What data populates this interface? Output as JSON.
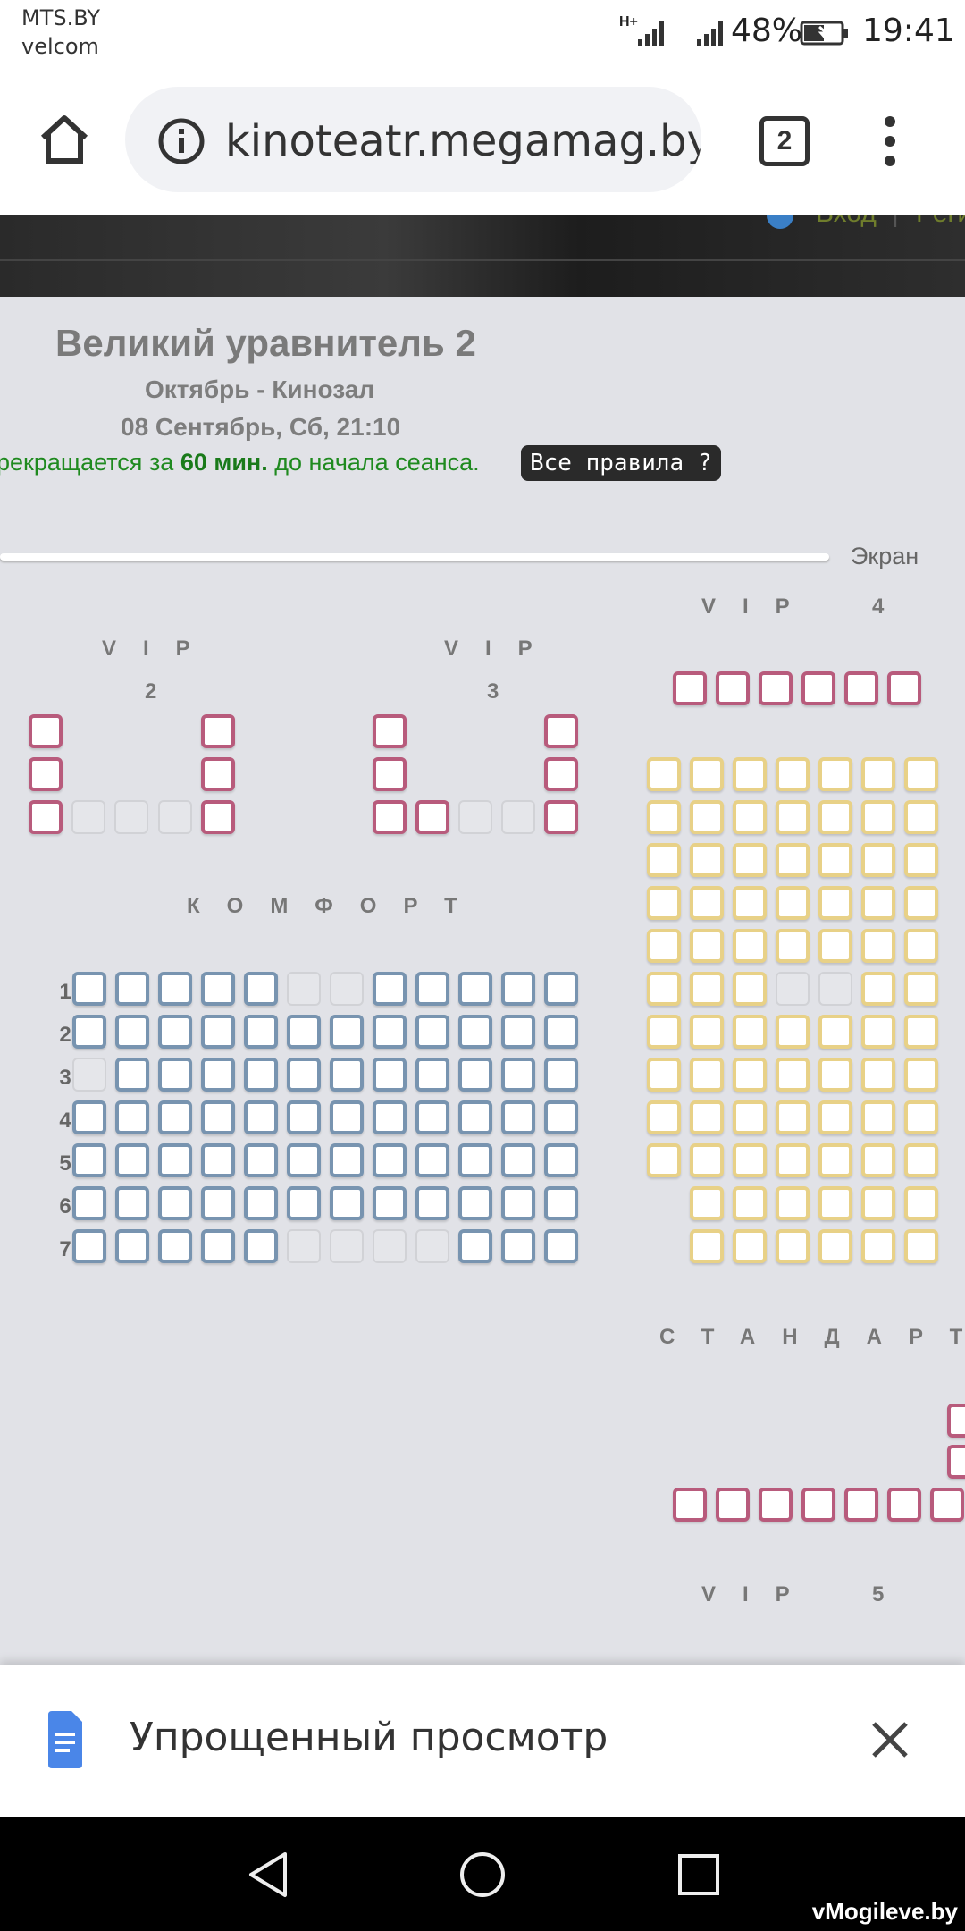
{
  "status": {
    "carrier1": "MTS.BY",
    "carrier2": "velcom",
    "network": "H+",
    "battery": "48%",
    "time": "19:41"
  },
  "browser": {
    "url": "kinoteatr.megamag.by/r",
    "tabs": "2"
  },
  "banner": {
    "login": "Вход",
    "separator": "|",
    "register": "Регис"
  },
  "movie": {
    "title": "Великий уравнитель 2",
    "cinema": "Октябрь - Кинозал",
    "datetime": "08 Сентябрь, Сб, 21:10",
    "notice_pre": "рекращается за ",
    "notice_bold": "60 мин.",
    "notice_post": " до начала сеанса.",
    "rules_button": "Все правила ?"
  },
  "hall": {
    "screen_label": "Экран",
    "vip2": "VIP",
    "vip2_num": "2",
    "vip3": "VIP",
    "vip3_num": "3",
    "vip4": "VIP",
    "vip4_num": "4",
    "vip5": "VIP",
    "vip5_num": "5",
    "comfort": "КОМФОРТ",
    "standard": "СТАНДАРТ",
    "rows": [
      "1",
      "2",
      "3",
      "4",
      "5",
      "6",
      "7"
    ],
    "comfort_seats": [
      "11111001111 1",
      "111111111111",
      "011111111111",
      "111111111111",
      "111111111111",
      "111111111111",
      "111110000111"
    ]
  },
  "reader_mode": {
    "label": "Упрощенный просмотр"
  },
  "watermark": "vMogileve.by"
}
